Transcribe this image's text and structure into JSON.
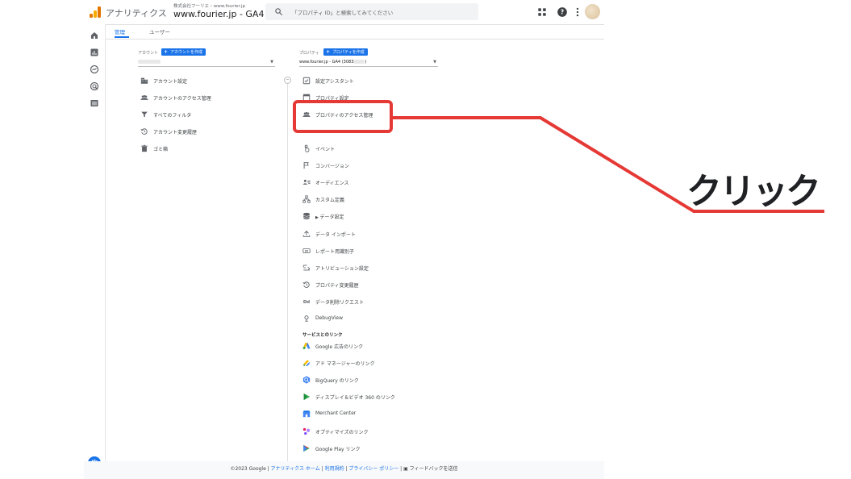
{
  "header": {
    "app_name": "アナリティクス",
    "breadcrumb_account": "株式会社フーリエ",
    "breadcrumb_property": "www.fourier.jp",
    "property_title": "www.fourier.jp - GA4",
    "search_placeholder": "「プロパティ ID」と検索してみてください",
    "icons": [
      "apps-grid-icon",
      "help-icon",
      "more-vert-icon",
      "avatar"
    ]
  },
  "rail": {
    "icons": [
      "home-icon",
      "reports-icon",
      "explore-icon",
      "advertising-icon",
      "list-icon",
      "settings-gear-icon"
    ]
  },
  "tabs": [
    {
      "label": "管理",
      "active": true
    },
    {
      "label": "ユーザー",
      "active": false
    }
  ],
  "account_column": {
    "label": "アカウント",
    "create_button": "アカウントを作成",
    "items": [
      {
        "label": "アカウント設定",
        "icon": "building-icon"
      },
      {
        "label": "アカウントのアクセス管理",
        "icon": "people-icon"
      },
      {
        "label": "すべてのフィルタ",
        "icon": "filter-icon"
      },
      {
        "label": "アカウント変更履歴",
        "icon": "history-icon"
      },
      {
        "label": "ゴミ箱",
        "icon": "trash-icon"
      }
    ]
  },
  "property_column": {
    "label": "プロパティ",
    "create_button": "プロパティを作成",
    "selected": "www.fourier.jp - GA4 (3083",
    "selected_suffix": ")",
    "items": [
      {
        "label": "設定アシスタント",
        "icon": "checkbox-icon"
      },
      {
        "label": "プロパティ設定",
        "icon": "window-icon"
      },
      {
        "label": "プロパティのアクセス管理",
        "icon": "people-icon"
      },
      {
        "label": "イベント",
        "icon": "touch-icon"
      },
      {
        "label": "コンバージョン",
        "icon": "flag-icon"
      },
      {
        "label": "オーディエンス",
        "icon": "audience-icon"
      },
      {
        "label": "カスタム定義",
        "icon": "custom-definitions-icon"
      },
      {
        "label": "データ設定",
        "icon": "database-icon"
      },
      {
        "label": "データ インポート",
        "icon": "upload-icon"
      },
      {
        "label": "レポート用識別子",
        "icon": "identifier-icon"
      },
      {
        "label": "アトリビューション設定",
        "icon": "attribution-icon"
      },
      {
        "label": "プロパティ変更履歴",
        "icon": "history-icon"
      },
      {
        "label": "データ削除リクエスト",
        "icon": "data-delete-icon"
      },
      {
        "label": "DebugView",
        "icon": "debug-icon"
      }
    ],
    "links_section_title": "サービスとのリンク",
    "links": [
      {
        "label": "Google 広告のリンク",
        "icon": "google-ads-icon"
      },
      {
        "label": "アド マネージャーのリンク",
        "icon": "ad-manager-icon"
      },
      {
        "label": "BigQuery のリンク",
        "icon": "bigquery-icon"
      },
      {
        "label": "ディスプレイ＆ビデオ 360 のリンク",
        "icon": "dv360-icon"
      },
      {
        "label": "Merchant Center",
        "icon": "merchant-center-icon"
      },
      {
        "label": "オプティマイズのリンク",
        "icon": "optimize-icon"
      },
      {
        "label": "Google Play リンク",
        "icon": "google-play-icon"
      }
    ]
  },
  "footer": {
    "copyright": "©2023 Google",
    "links": [
      "アナリティクス ホーム",
      "利用規約",
      "プライバシー ポリシー"
    ],
    "feedback": "フィードバックを送信"
  },
  "annotation": {
    "text": "クリック",
    "color": "#e53935"
  },
  "colors": {
    "accent": "#1a73e8",
    "annotation_red": "#e53935"
  }
}
